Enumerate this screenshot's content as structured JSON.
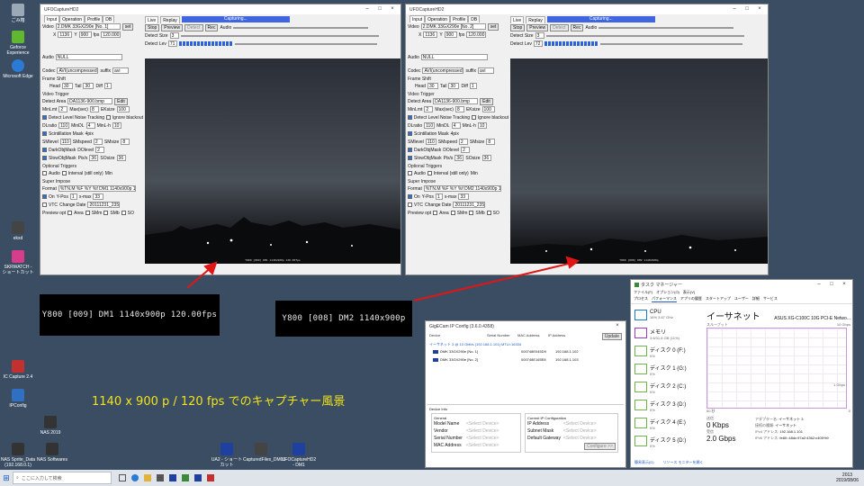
{
  "desktop": {
    "icons": [
      {
        "label": "ごみ箱",
        "color": "#9aa8b8"
      },
      {
        "label": "Geforce Experience",
        "color": "#5fb830"
      },
      {
        "label": "Microsoft Edge",
        "color": "#2b7bd6"
      },
      {
        "label": "ekxd",
        "color": "#444"
      },
      {
        "label": "SKRWATCH - ショートカット",
        "color": "#d63d8a"
      },
      {
        "label": "IC Capture 2.4",
        "color": "#c23030"
      },
      {
        "label": "IPConfig",
        "color": "#3070c2"
      },
      {
        "label": "NAS 2019",
        "color": "#333"
      },
      {
        "label": "NAS Sprite_Data (192.168.0.1)",
        "color": "#333"
      },
      {
        "label": "NAS Softwares",
        "color": "#333"
      },
      {
        "label": "UA2 - ショートカット",
        "color": "#2040a0"
      },
      {
        "label": "CapturedFiles_DM01",
        "color": "#444"
      },
      {
        "label": "UFOCaptureHD2 - DM1",
        "color": "#2040a0"
      }
    ]
  },
  "ufo": [
    {
      "title": "UFOCaptureHD2",
      "tabs": [
        "Input",
        "Operation",
        "Profile",
        "DB"
      ],
      "right_tabs": [
        "Live",
        "Replay"
      ],
      "video_label": "Video",
      "camera": "2.DMK 33GX290e [No. 1]",
      "set": "set",
      "x": "1136",
      "y": "900",
      "fps": "120.000",
      "audio_label": "Audio",
      "audio_value": "NULL",
      "codec_label": "Codec",
      "codec_value": "AVI(uncompressed)",
      "suffix_label": "suffix",
      "suffix_value": "avi",
      "frame_shift": "Frame Shift",
      "head": "Head",
      "head_val": "30",
      "tail": "Tail",
      "tail_val": "30",
      "diff": "Diff",
      "diff_val": "1",
      "video_trigger": "Video Trigger",
      "detect_area": "Detect Area",
      "detect_area_val": "DA1136-900.bmp",
      "edit": "Edit",
      "minlmt": "MinLmt",
      "minlmt_val": "2",
      "maxlmt": "Max(sec)",
      "maxlmt_val": "8",
      "eksize": "EKsize",
      "eksize_val": "100",
      "noise_tracking": "Detect Level Noise Tracking",
      "ignore_blackout": "Ignore blackout",
      "dlratio": "DLratio",
      "dlratio_val": "110",
      "minDL": "MinDL",
      "minDL_val": "4",
      "minlh": "MinL-h",
      "minlh_val": "10",
      "scint": "Scintillation Mask",
      "fps4": "4pix",
      "smlevel": "SMlevel",
      "smlevel_val": "110",
      "smspeed": "SMspeed",
      "smspeed_val": "2",
      "smsize": "SMsize",
      "smsize_val": "8",
      "darkobj": "DarkObjMask",
      "dolevel": "DOlevel",
      "dolevel_val": "2",
      "slowobj": "SlowObjMask",
      "pix": "Pix/s",
      "pix_val": "36",
      "sosize": "SOsize",
      "sosize_val": "36",
      "opt_triggers": "Optional Triggers",
      "audio_chk": "Audio",
      "interval": "Interval (still only)",
      "min": "Min",
      "super_impose": "Super Impose",
      "format": "Format",
      "format_val": "%TN.M %F %Y %f DM1 1140x900p 120.00fps",
      "on_label": "On",
      "xpos": "X-Pos",
      "ypos": "Y-Pos",
      "ypos_val": "1",
      "xmax_val": "33",
      "xmax": "x-max",
      "vtc": "VTC",
      "change_date": "Change Date",
      "date_val": "20111231_235959",
      "preview_opt": "Preview opt",
      "area": "Area",
      "smm": "SMm",
      "smb": "SMb",
      "so": "SO",
      "stop": "Stop",
      "preview": "Preview",
      "detect": "Detect",
      "rec": "Rec",
      "audio_btn": "Audio",
      "detect_size": "Detect Size",
      "detect_size_val": "3",
      "detect_lev": "Detect Lev",
      "detect_lev_val": "71",
      "status_text": "Capturing...",
      "overlay": "Y800 [009] DM1 1140x900p 120.00fps"
    },
    {
      "title": "UFOCaptureHD2",
      "tabs": [
        "Input",
        "Operation",
        "Profile",
        "DB"
      ],
      "right_tabs": [
        "Live",
        "Replay"
      ],
      "video_label": "Video",
      "camera": "2.DMK 33GX290e [No. 2]",
      "set": "set",
      "x": "1136",
      "y": "900",
      "fps": "120.000",
      "audio_label": "Audio",
      "audio_value": "NULL",
      "codec_label": "Codec",
      "codec_value": "AVI(uncompressed)",
      "suffix_label": "suffix",
      "suffix_value": "avi",
      "frame_shift": "Frame Shift",
      "head": "Head",
      "head_val": "30",
      "tail": "Tail",
      "tail_val": "30",
      "diff": "Diff",
      "diff_val": "1",
      "video_trigger": "Video Trigger",
      "detect_area": "Detect Area",
      "detect_area_val": "DA1136-900.bmp",
      "edit": "Edit",
      "minlmt": "MinLmt",
      "minlmt_val": "2",
      "maxlmt": "Max(sec)",
      "maxlmt_val": "8",
      "eksize": "EKsize",
      "eksize_val": "100",
      "noise_tracking": "Detect Level Noise Tracking",
      "ignore_blackout": "Ignore blackout",
      "dlratio": "DLratio",
      "dlratio_val": "110",
      "minDL": "MinDL",
      "minDL_val": "4",
      "minlh": "MinL-h",
      "minlh_val": "10",
      "scint": "Scintillation Mask",
      "fps4": "4pix",
      "smlevel": "SMlevel",
      "smlevel_val": "110",
      "smspeed": "SMspeed",
      "smspeed_val": "2",
      "smsize": "SMsize",
      "smsize_val": "8",
      "darkobj": "DarkObjMask",
      "dolevel": "DOlevel",
      "dolevel_val": "2",
      "slowobj": "SlowObjMask",
      "pix": "Pix/s",
      "pix_val": "36",
      "sosize": "SOsize",
      "sosize_val": "36",
      "opt_triggers": "Optional Triggers",
      "audio_chk": "Audio",
      "interval": "Interval (still only)",
      "min": "Min",
      "super_impose": "Super Impose",
      "format": "Format",
      "format_val": "%TN.M %F %Y %f DM2 1140x900p 120.00fps",
      "on_label": "On",
      "xpos": "X-Pos",
      "ypos": "Y-Pos",
      "ypos_val": "1",
      "xmax_val": "33",
      "xmax": "x-max",
      "vtc": "VTC",
      "change_date": "Change Date",
      "date_val": "20111231_235959",
      "preview_opt": "Preview opt",
      "area": "Area",
      "smm": "SMm",
      "smb": "SMb",
      "so": "SO",
      "stop": "Stop",
      "preview": "Preview",
      "detect": "Detect",
      "rec": "Rec",
      "audio_btn": "Audio",
      "detect_size": "Detect Size",
      "detect_size_val": "3",
      "detect_lev": "Detect Lev",
      "detect_lev_val": "72",
      "status_text": "Capturing...",
      "overlay": "Y800 [008] DM2 1140x900p"
    }
  ],
  "banners": [
    "Y800 [009]  DM1 1140x900p 120.00fps",
    "Y800 [008]  DM2 1140x900p"
  ],
  "caption": "1140 x 900 p / 120 fps でのキャプチャー風景",
  "gigecam": {
    "title": "GigECam IP Config (3.6.0.4358)",
    "headers": [
      "Device",
      "Serial Number",
      "MAC Address",
      "IP Address"
    ],
    "update": "Update",
    "group": "イーサネット 3 @ 10 Gbit/s (192.168.1.101) MTU=16334",
    "devices": [
      {
        "name": "DMK 33GX290e [No. 1]",
        "serial": "",
        "mac": "000748E045D9",
        "ip": "192.168.1.102"
      },
      {
        "name": "DMK 33GX290e [No. 2]",
        "serial": "",
        "mac": "000748E165E8",
        "ip": "192.168.1.103"
      }
    ],
    "device_info": "Device Info",
    "general": "General",
    "model_name": "Model Name",
    "vendor": "Vendor",
    "serial_number": "Serial Number",
    "mac_address": "MAC Address",
    "select_device": "<Select Device>",
    "current_ip": "Current IP Configuration",
    "ip_address": "IP Address",
    "subnet": "Subnet Mask",
    "gateway": "Default Gateway",
    "configure": "Configure >>"
  },
  "taskmgr": {
    "title": "タスク マネージャー",
    "menu": [
      "ファイル(F)",
      "オプション(O)",
      "表示(V)"
    ],
    "tabs": [
      "プロセス",
      "パフォーマンス",
      "アプリの履歴",
      "スタートアップ",
      "ユーザー",
      "詳細",
      "サービス"
    ],
    "side": [
      {
        "name": "CPU",
        "detail": "16%  3.67 GHz",
        "color": "#1e78c8"
      },
      {
        "name": "メモリ",
        "detail": "3.6/31.8 GB (11%)",
        "color": "#9b3ac2"
      },
      {
        "name": "ディスク 0 (F:)",
        "detail": "0%",
        "color": "#5fb830"
      },
      {
        "name": "ディスク 1 (G:)",
        "detail": "0%",
        "color": "#5fb830"
      },
      {
        "name": "ディスク 2 (C:)",
        "detail": "0%",
        "color": "#5fb830"
      },
      {
        "name": "ディスク 3 (D:)",
        "detail": "0%",
        "color": "#5fb830"
      },
      {
        "name": "ディスク 4 (E:)",
        "detail": "0%",
        "color": "#5fb830"
      },
      {
        "name": "ディスク 5 (D:)",
        "detail": "0%",
        "color": "#5fb830"
      }
    ],
    "main_title": "イーサネット",
    "adapter": "ASUS XG-C100C 10G PCI-E Netwo...",
    "throughput": "スループット",
    "max_val": "10 Gbps",
    "mid_val": "1 Gbps",
    "time_label": "60 秒",
    "zero": "0",
    "send_label": "送信",
    "send_val": "0 Kbps",
    "recv_label": "受信",
    "recv_val": "2.0 Gbps",
    "adapter_name_label": "アダプター名:",
    "adapter_name": "イーサネット 3",
    "conn_type_label": "接続の種類:",
    "conn_type": "イーサネット",
    "ipv4_label": "IPv4 アドレス:",
    "ipv4": "192.168.1.101",
    "ipv6_label": "IPv6 アドレス:",
    "ipv6": "fe80::48dc:97a2:4362:c405%9",
    "simple": "簡易表示(D)",
    "monitor": "リソース モニターを開く"
  },
  "taskbar": {
    "search_placeholder": "ここに入力して検索",
    "time": "2013",
    "date": "2019/08/06"
  }
}
